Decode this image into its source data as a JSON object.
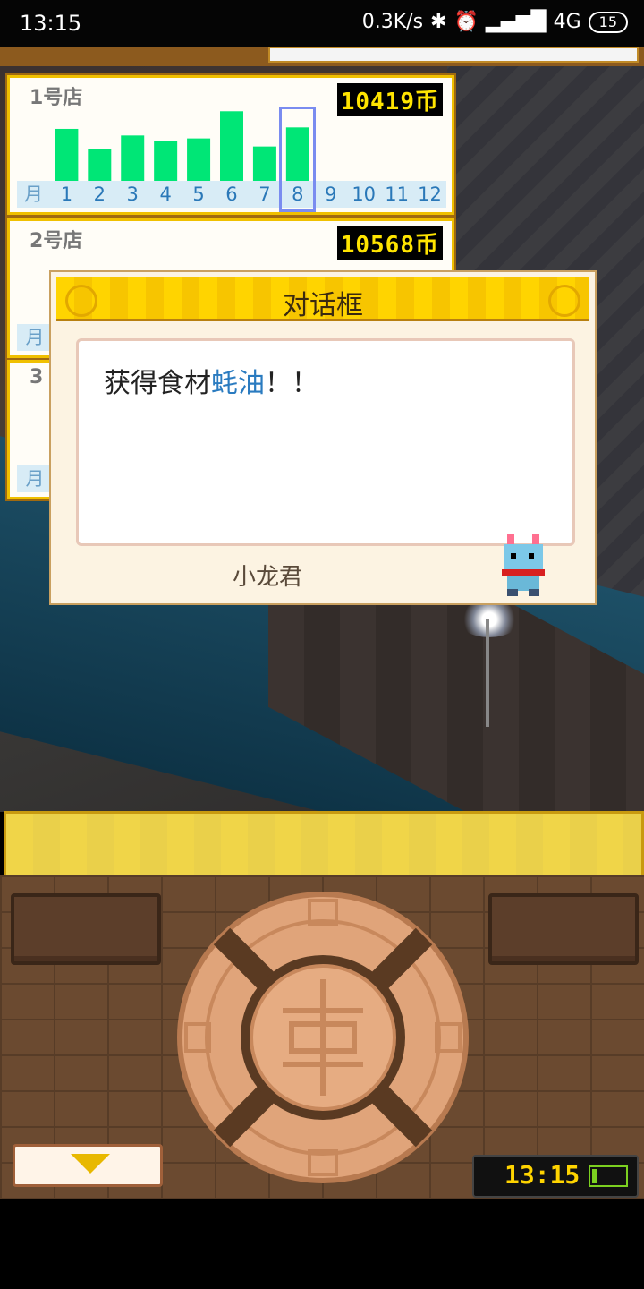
{
  "status_bar": {
    "time": "13:15",
    "network_speed": "0.3K/s",
    "network_type": "4G",
    "battery_level": "15"
  },
  "stores": [
    {
      "name": "1号店",
      "amount": "10419",
      "currency": "币",
      "month_label": "月",
      "months": [
        "1",
        "2",
        "3",
        "4",
        "5",
        "6",
        "7",
        "8",
        "9",
        "10",
        "11",
        "12"
      ],
      "selected_month": 8,
      "monthly_sales_relative": [
        0.72,
        0.44,
        0.63,
        0.56,
        0.59,
        0.96,
        0.48,
        0.74
      ]
    },
    {
      "name": "2号店",
      "amount": "10568",
      "currency": "币",
      "month_label": "月"
    },
    {
      "name": "3",
      "month_label": "月"
    }
  ],
  "dialog": {
    "title": "对话框",
    "message_prefix": "获得食材",
    "message_highlight": "蚝油",
    "message_suffix": "！！",
    "speaker": "小龙君"
  },
  "clock": {
    "time": "13:15"
  },
  "colors": {
    "bar_green": "#00e676",
    "highlight_blue": "#2a7bc0",
    "gold": "#ffd400"
  }
}
